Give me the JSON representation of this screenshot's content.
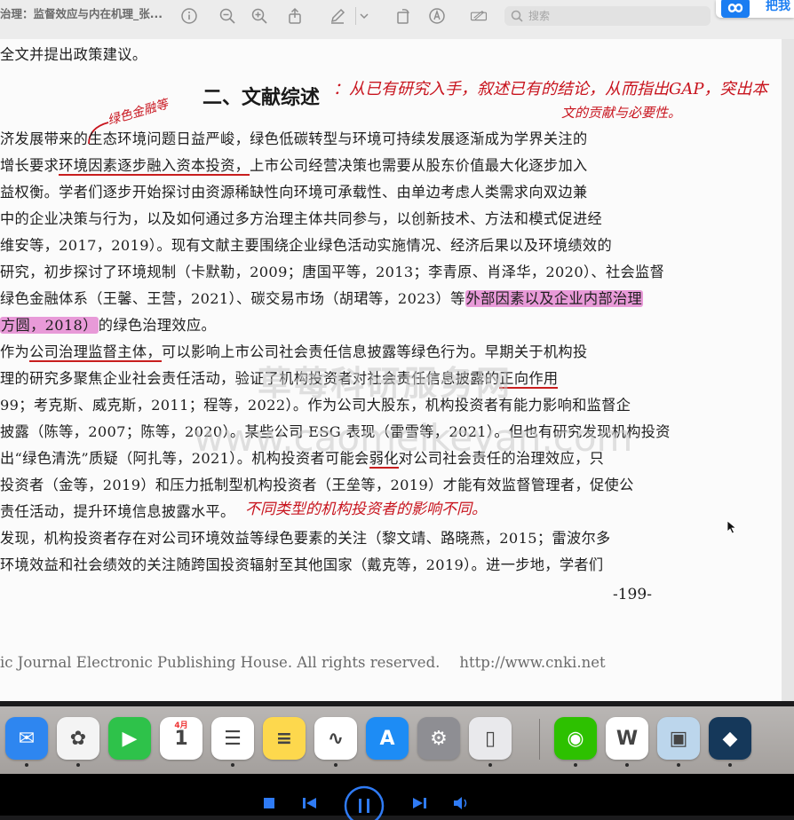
{
  "toolbar": {
    "doc_title": "治理：监督效应与内在机理_张...",
    "search_placeholder": "搜索",
    "app_badge": "把我"
  },
  "document": {
    "top_line": "全文并提出政策建议。",
    "heading": "二、文献综述",
    "lines": [
      {
        "text": "济发展带来的生态环境问题日益严峻，绿色低碳转型与环境可持续发展逐渐成为学界关注的"
      },
      {
        "pre": "增长要求",
        "ul": "环境因素逐步融入资本投资，",
        "post": "上市公司经营决策也需要从股东价值最大化逐步加入"
      },
      {
        "text": "益权衡。学者们逐步开始探讨由资源稀缺性向环境可承载性、由单边考虑人类需求向双边兼"
      },
      {
        "text": "中的企业决策与行为，以及如何通过多方治理主体共同参与，以创新技术、方法和模式促进经"
      },
      {
        "text": "维安等，2017，2019）。现有文献主要围绕企业绿色活动实施情况、经济后果以及环境绩效的"
      },
      {
        "text": "研究，初步探讨了环境规制（卡默勒，2009；唐国平等，2013；李青原、肖泽华，2020）、社会监督"
      },
      {
        "pre": "绿色金融体系（王馨、王营，2021）、碳交易市场（胡珺等，2023）等",
        "hl": "外部因素以及企业内部治理"
      },
      {
        "hl": "方圆，2018）",
        "post": "的绿色治理效应。"
      },
      {
        "pre": "作为",
        "ul": "公司治理监督主体，",
        "post": "可以影响上市公司社会责任信息披露等绿色行为。早期关于机构投"
      },
      {
        "pre": "理的研究多聚焦企业社会责任活动，验证了机构投资者对社会责任信息披露的",
        "ul": "正向作用"
      },
      {
        "text": "99；考克斯、威克斯，2011；程等，2022）。作为公司大股东，机构投资者有能力影响和监督企"
      },
      {
        "text": "披露（陈等，2007；陈等，2020）。某些公司 ESG 表现（雷雪等，2021）。但也有研究发现机构投资"
      },
      {
        "text": "出“绿色清洗”质疑（阿扎等，2021）。机构投资者可能会",
        "ul": "弱化",
        "post": "对公司社会责任的治理效应，只"
      },
      {
        "text": "投资者（金等，2019）和压力抵制型机构投资者（王垒等，2019）才能有效监督管理者，促使公"
      },
      {
        "text": "责任活动，提升环境信息披露水平。"
      },
      {
        "text": "发现，机构投资者存在对公司环境效益等绿色要素的关注（黎文靖、路晓燕，2015；雷波尔多"
      },
      {
        "text": "环境效益和社会绩效的关注随跨国投资辐射至其他国家（戴克等，2019）。进一步地，学者们"
      }
    ],
    "page_number": "-199-",
    "footer_text": "ic Journal Electronic Publishing House. All rights reserved.",
    "footer_url": "http://www.cnki.net"
  },
  "annotations": {
    "heading_note_1": "：从已有研究入手，叙述已有的结论，从而指出GAP，突出本",
    "heading_note_2": "文的贡献与必要性。",
    "margin_note": "绿色金融等",
    "line15_note": "不同类型的机构投资者的影响不同。"
  },
  "watermark": {
    "line1": "草莓科研服务网",
    "line2": "www.caomeikeyan.com"
  },
  "dock": [
    {
      "name": "mail-app",
      "label": "✉",
      "color": "#2e86f0"
    },
    {
      "name": "photos-app",
      "label": "✿",
      "color": "#f4f4f4"
    },
    {
      "name": "facetime-app",
      "label": "▶",
      "color": "#2ec24a"
    },
    {
      "name": "calendar-app",
      "label": "1",
      "color": "#ffffff",
      "sub": "4月"
    },
    {
      "name": "reminders-app",
      "label": "☰",
      "color": "#ffffff"
    },
    {
      "name": "notes-app",
      "label": "≡",
      "color": "#fdd84d"
    },
    {
      "name": "freeform-app",
      "label": "∿",
      "color": "#ffffff"
    },
    {
      "name": "app-store-app",
      "label": "A",
      "color": "#1d8cf5"
    },
    {
      "name": "system-settings-app",
      "label": "⚙",
      "color": "#8e8e93"
    },
    {
      "name": "iphone-mirroring-app",
      "label": "▯",
      "color": "#e9e9ec"
    },
    {
      "name": "wechat-app",
      "label": "◉",
      "color": "#2dc100"
    },
    {
      "name": "word-app",
      "label": "W",
      "color": "#ffffff"
    },
    {
      "name": "preview-app",
      "label": "▣",
      "color": "#bcd6ec"
    },
    {
      "name": "video-app",
      "label": "◆",
      "color": "#15385a"
    }
  ],
  "colors": {
    "highlight": "#e89ad8",
    "ink_red": "#c8141e",
    "player_accent": "#2f7bf5"
  }
}
